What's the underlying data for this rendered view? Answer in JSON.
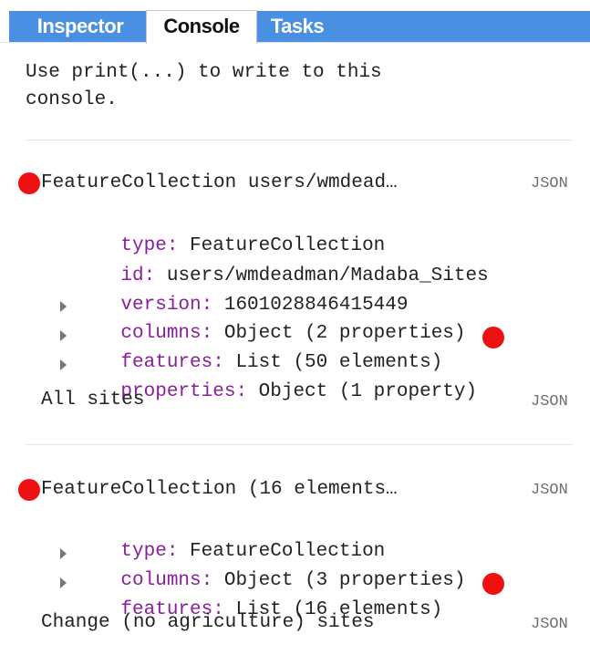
{
  "tabs": [
    {
      "label": "Inspector"
    },
    {
      "label": "Console"
    },
    {
      "label": "Tasks"
    }
  ],
  "console": {
    "intro_line1": "Use print(...) to write to this",
    "intro_line2": "console.",
    "json_label": "JSON",
    "entry1": {
      "header": "FeatureCollection users/wmdead…",
      "type_key": "type:",
      "type_val": " FeatureCollection",
      "id_key": "id:",
      "id_val": " users/wmdeadman/Madaba_Sites",
      "version_key": "version:",
      "version_val": " 1601028846415449",
      "columns_key": "columns:",
      "columns_val": " Object (2 properties)",
      "features_key": "features:",
      "features_val": " List (50 elements)",
      "properties_key": "properties:",
      "properties_val": " Object (1 property)",
      "print_label": "All sites"
    },
    "entry2": {
      "header": "FeatureCollection (16 elements…",
      "type_key": "type:",
      "type_val": " FeatureCollection",
      "columns_key": "columns:",
      "columns_val": " Object (3 properties)",
      "features_key": "features:",
      "features_val": " List (16 elements)",
      "print_label": "Change (no agriculture) sites"
    }
  },
  "colors": {
    "tab_blue": "#4a90e2",
    "marker_red": "#ee1111",
    "key_purple": "#8b1e9e"
  }
}
